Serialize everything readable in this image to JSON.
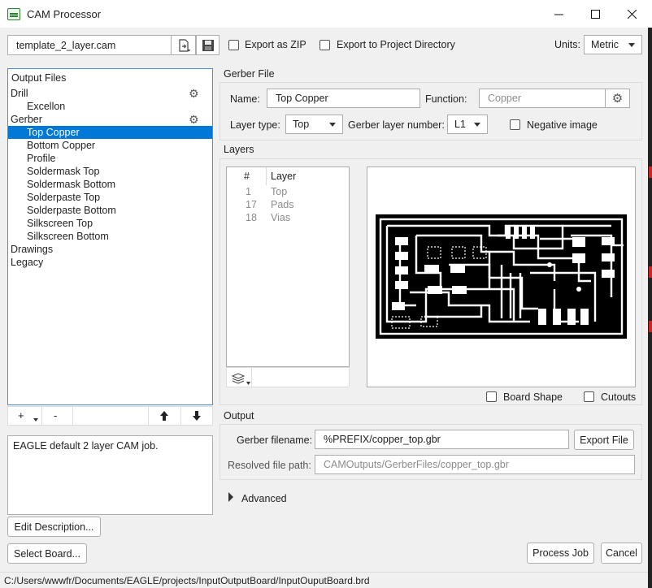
{
  "window": {
    "title": "CAM Processor",
    "minimize_icon": "minimize-icon",
    "maximize_icon": "maximize-icon",
    "close_icon": "close-icon"
  },
  "toolbar": {
    "template_value": "template_2_layer.cam",
    "export_zip_label": "Export as ZIP",
    "export_project_label": "Export to Project Directory",
    "units_label": "Units:",
    "units_value": "Metric"
  },
  "output_files": {
    "header": "Output Files",
    "items": [
      {
        "label": "Drill",
        "level": 0
      },
      {
        "label": "Excellon",
        "level": 1
      },
      {
        "label": "Gerber",
        "level": 0
      },
      {
        "label": "Top Copper",
        "level": 1,
        "selected": true
      },
      {
        "label": "Bottom Copper",
        "level": 1
      },
      {
        "label": "Profile",
        "level": 1
      },
      {
        "label": "Soldermask Top",
        "level": 1
      },
      {
        "label": "Soldermask Bottom",
        "level": 1
      },
      {
        "label": "Solderpaste Top",
        "level": 1
      },
      {
        "label": "Solderpaste Bottom",
        "level": 1
      },
      {
        "label": "Silkscreen Top",
        "level": 1
      },
      {
        "label": "Silkscreen Bottom",
        "level": 1
      },
      {
        "label": "Drawings",
        "level": 0
      },
      {
        "label": "Legacy",
        "level": 0
      }
    ],
    "add_label": "+",
    "remove_label": "-"
  },
  "description": {
    "text": "EAGLE default 2 layer CAM job.",
    "edit_button": "Edit Description...",
    "select_board_button": "Select Board..."
  },
  "gerber_file": {
    "section_title": "Gerber File",
    "name_label": "Name:",
    "name_value": "Top Copper",
    "function_label": "Function:",
    "function_value": "Copper",
    "layer_type_label": "Layer type:",
    "layer_type_value": "Top",
    "layer_number_label": "Gerber layer number:",
    "layer_number_value": "L1",
    "negative_label": "Negative image"
  },
  "layers": {
    "section_title": "Layers",
    "col_number": "#",
    "col_layer": "Layer",
    "rows": [
      {
        "num": "1",
        "name": "Top"
      },
      {
        "num": "17",
        "name": "Pads"
      },
      {
        "num": "18",
        "name": "Vias"
      }
    ],
    "board_shape_label": "Board Shape",
    "cutouts_label": "Cutouts"
  },
  "output": {
    "section_title": "Output",
    "filename_label": "Gerber filename:",
    "filename_value": "%PREFIX/copper_top.gbr",
    "export_button": "Export File",
    "resolved_label": "Resolved file path:",
    "resolved_value": "CAMOutputs/GerberFiles/copper_top.gbr",
    "advanced_label": "Advanced"
  },
  "actions": {
    "process_button": "Process Job",
    "cancel_button": "Cancel"
  },
  "status": {
    "path": "C:/Users/wwwfr/Documents/EAGLE/projects/InputOutputBoard/InputOuputBoard.brd"
  },
  "colors": {
    "accent": "#0078d7",
    "pcb_background": "#000000",
    "pcb_trace": "#ffffff"
  }
}
